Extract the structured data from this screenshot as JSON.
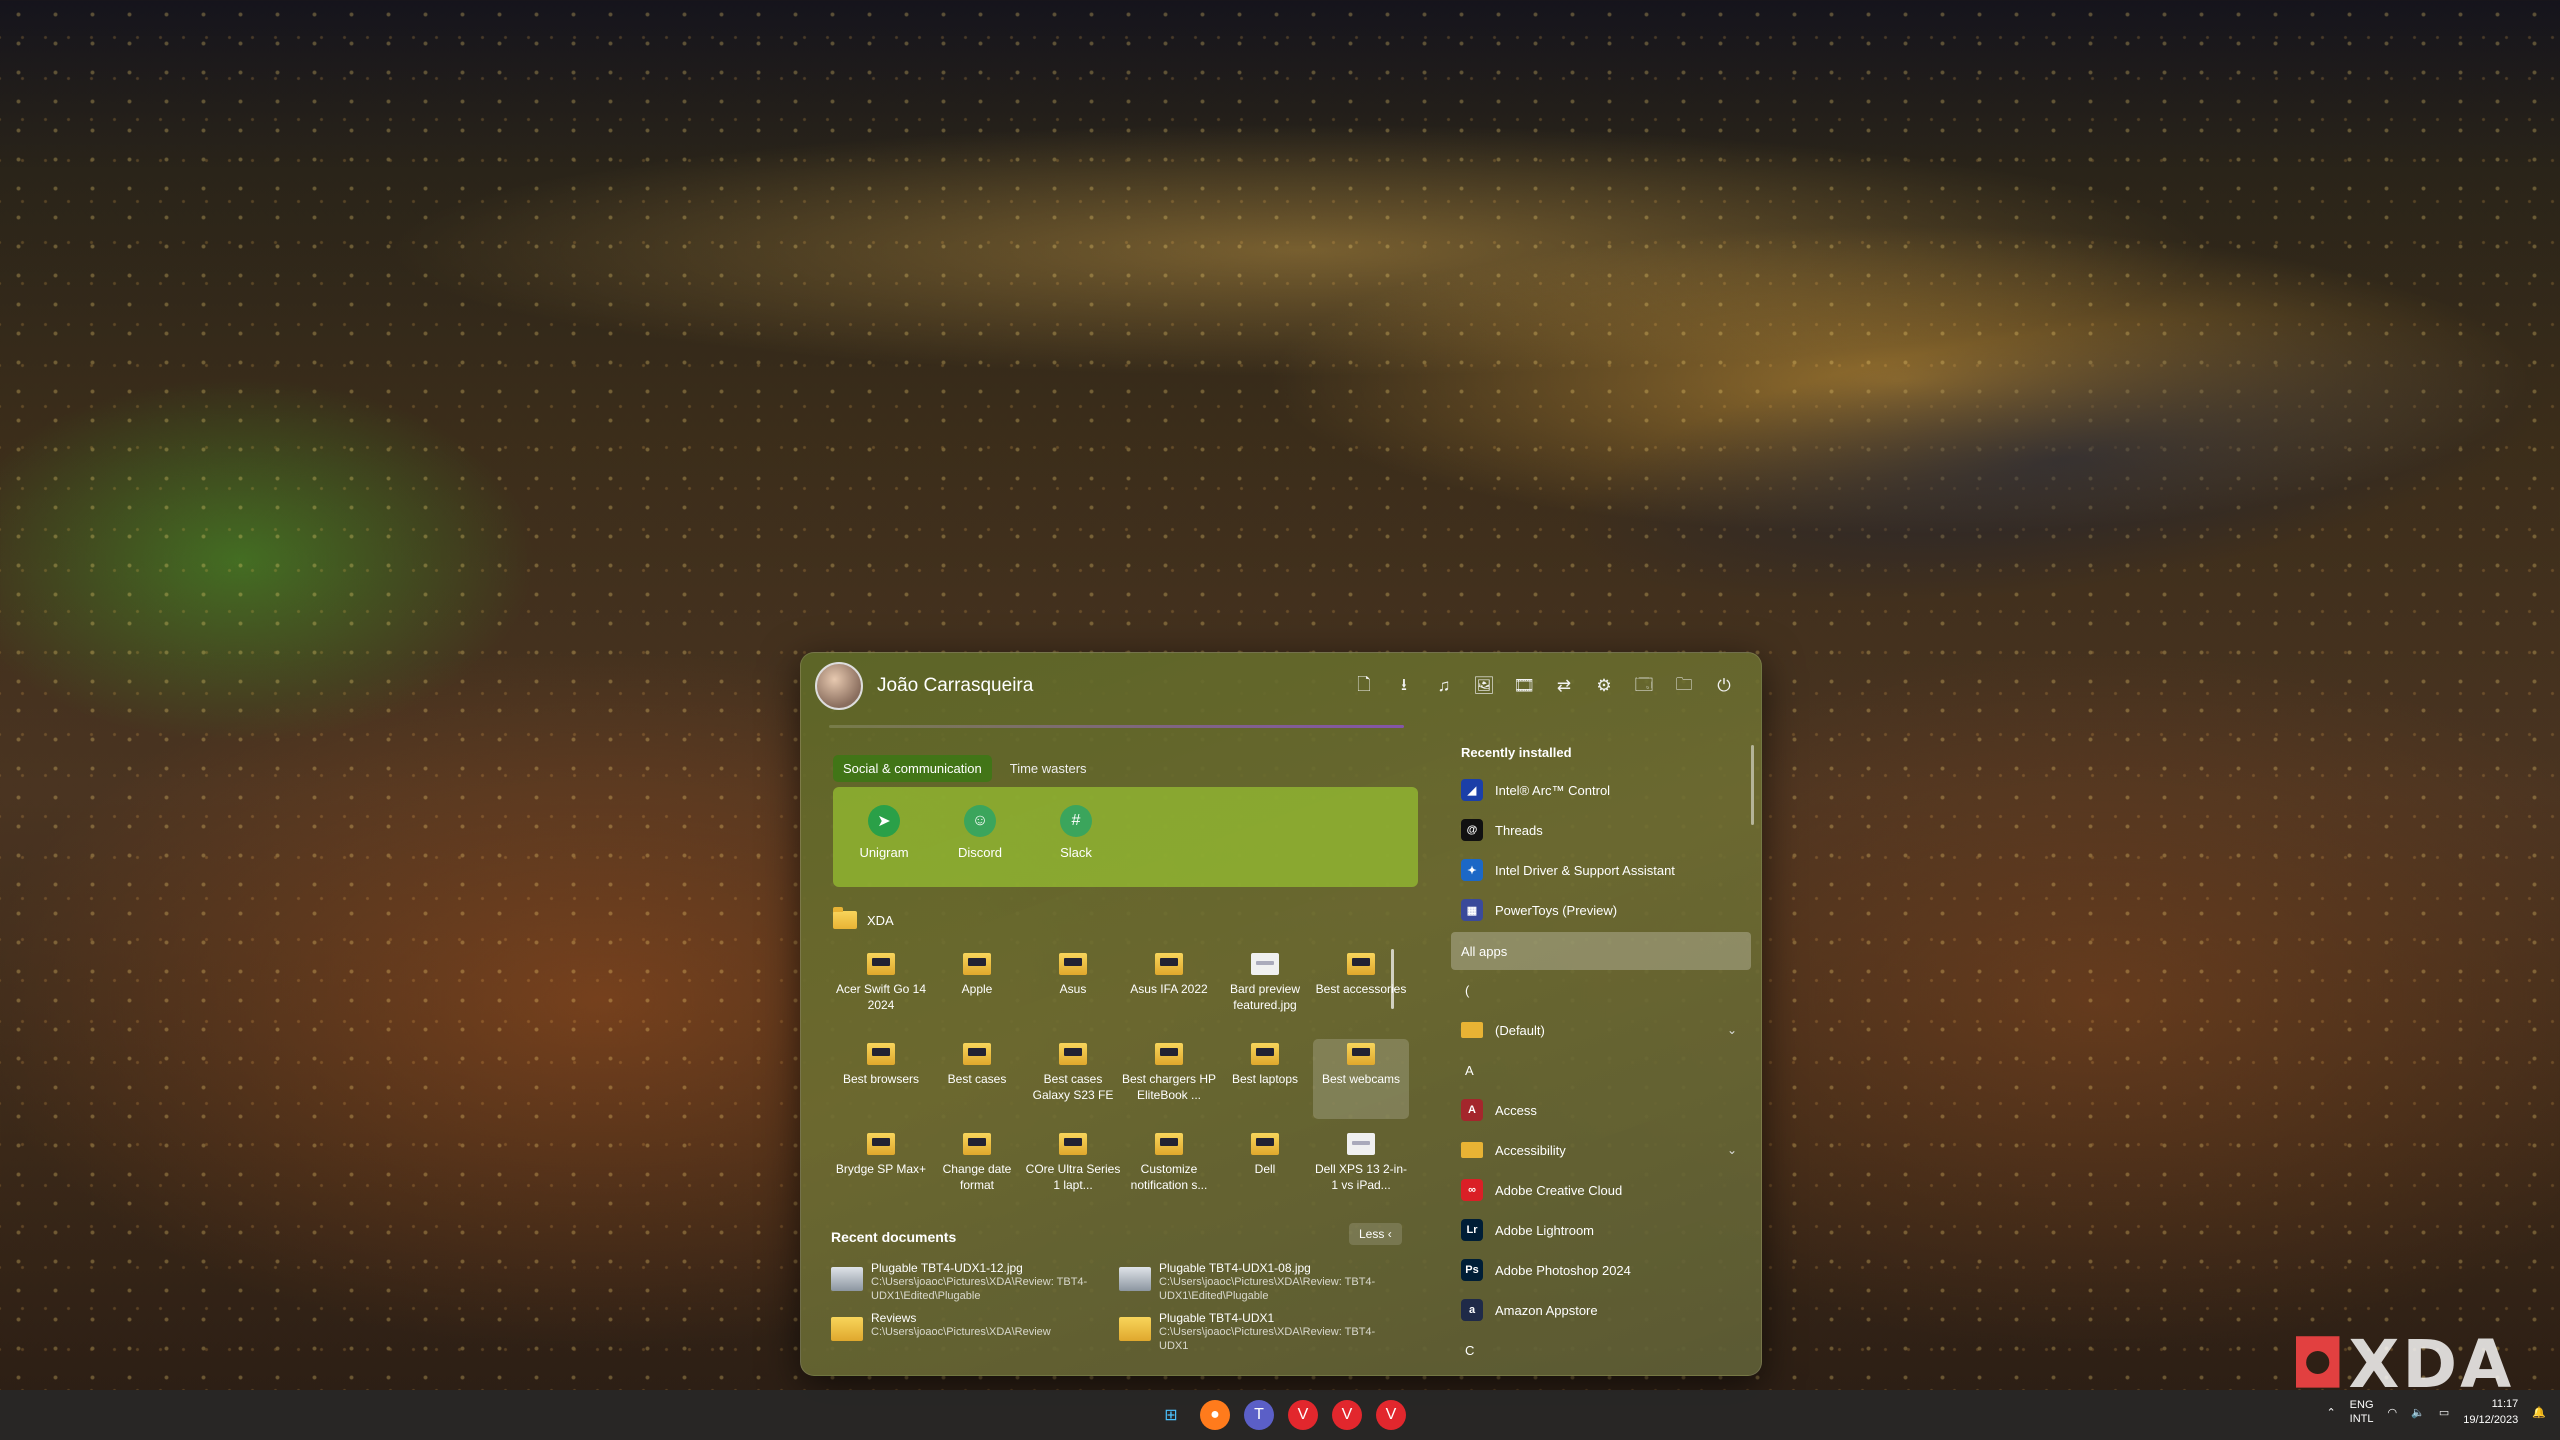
{
  "user": {
    "name": "João Carrasqueira"
  },
  "header_icons": [
    "document-icon",
    "download-icon",
    "music-icon",
    "image-icon",
    "video-icon",
    "network-icon",
    "settings-icon",
    "explorer-icon",
    "folder-icon",
    "power-icon"
  ],
  "tabs": [
    {
      "label": "Social & communication",
      "active": true
    },
    {
      "label": "Time wasters",
      "active": false
    }
  ],
  "group_apps": [
    {
      "label": "Unigram",
      "icon": "telegram-icon",
      "color": "#2aa048"
    },
    {
      "label": "Discord",
      "icon": "discord-icon",
      "color": "#3ba55c"
    },
    {
      "label": "Slack",
      "icon": "slack-icon",
      "color": "#3ba55c"
    }
  ],
  "folder": {
    "label": "XDA"
  },
  "folder_items": [
    {
      "label": "Acer Swift Go 14 2024",
      "type": "folder"
    },
    {
      "label": "Apple",
      "type": "folder"
    },
    {
      "label": "Asus",
      "type": "folder"
    },
    {
      "label": "Asus IFA 2022",
      "type": "folder"
    },
    {
      "label": "Bard preview featured.jpg",
      "type": "file"
    },
    {
      "label": "Best accessories",
      "type": "folder"
    },
    {
      "label": "Best browsers",
      "type": "folder"
    },
    {
      "label": "Best cases",
      "type": "folder"
    },
    {
      "label": "Best cases Galaxy S23 FE",
      "type": "folder"
    },
    {
      "label": "Best chargers HP EliteBook ...",
      "type": "folder"
    },
    {
      "label": "Best laptops",
      "type": "folder"
    },
    {
      "label": "Best webcams",
      "type": "folder",
      "selected": true
    },
    {
      "label": "Brydge SP Max+",
      "type": "folder"
    },
    {
      "label": "Change date format",
      "type": "folder"
    },
    {
      "label": "COre Ultra Series 1 lapt...",
      "type": "folder"
    },
    {
      "label": "Customize notification s...",
      "type": "folder"
    },
    {
      "label": "Dell",
      "type": "folder"
    },
    {
      "label": "Dell XPS 13 2-in-1 vs iPad...",
      "type": "file"
    }
  ],
  "recent": {
    "title": "Recent documents",
    "toggle": "Less",
    "items": [
      {
        "name": "Plugable TBT4-UDX1-12.jpg",
        "path": "C:\\Users\\joaoc\\Pictures\\XDA\\Review: TBT4-UDX1\\Edited\\Plugable",
        "type": "image"
      },
      {
        "name": "Plugable TBT4-UDX1-08.jpg",
        "path": "C:\\Users\\joaoc\\Pictures\\XDA\\Review: TBT4-UDX1\\Edited\\Plugable",
        "type": "image"
      },
      {
        "name": "Reviews",
        "path": "C:\\Users\\joaoc\\Pictures\\XDA\\Review",
        "type": "folder"
      },
      {
        "name": "Plugable TBT4-UDX1",
        "path": "C:\\Users\\joaoc\\Pictures\\XDA\\Review: TBT4-UDX1",
        "type": "folder"
      }
    ]
  },
  "right": {
    "recent_title": "Recently installed",
    "recent_items": [
      {
        "label": "Intel® Arc™ Control",
        "icon": "intel-arc-icon",
        "color": "#1b3fa8",
        "glyph": "◢"
      },
      {
        "label": "Threads",
        "icon": "threads-icon",
        "color": "#111111",
        "glyph": "@"
      },
      {
        "label": "Intel Driver & Support Assistant",
        "icon": "intel-dsa-icon",
        "color": "#1c68c6",
        "glyph": "✦"
      },
      {
        "label": "PowerToys (Preview)",
        "icon": "powertoys-icon",
        "color": "#3a4a9a",
        "glyph": "▦"
      }
    ],
    "all_apps": "All apps",
    "list": [
      {
        "kind": "letter",
        "label": "("
      },
      {
        "kind": "app",
        "label": "(Default)",
        "icon": "folder-icon",
        "color": "#e8b334",
        "glyph": "",
        "expand": true
      },
      {
        "kind": "letter",
        "label": "A"
      },
      {
        "kind": "app",
        "label": "Access",
        "icon": "access-icon",
        "color": "#a4262c",
        "glyph": "A"
      },
      {
        "kind": "app",
        "label": "Accessibility",
        "icon": "folder-icon",
        "color": "#e8b334",
        "glyph": "",
        "expand": true
      },
      {
        "kind": "app",
        "label": "Adobe Creative Cloud",
        "icon": "creative-cloud-icon",
        "color": "#da1f26",
        "glyph": "∞"
      },
      {
        "kind": "app",
        "label": "Adobe Lightroom",
        "icon": "lightroom-icon",
        "color": "#001e36",
        "glyph": "Lr"
      },
      {
        "kind": "app",
        "label": "Adobe Photoshop 2024",
        "icon": "photoshop-icon",
        "color": "#001e36",
        "glyph": "Ps"
      },
      {
        "kind": "app",
        "label": "Amazon Appstore",
        "icon": "amazon-appstore-icon",
        "color": "#1f2a48",
        "glyph": "a"
      },
      {
        "kind": "letter",
        "label": "C"
      }
    ]
  },
  "taskbar": {
    "apps": [
      "windows-icon",
      "firefox-icon",
      "teams-icon",
      "vivaldi-icon",
      "vivaldi-snapshot-icon",
      "vivaldi-icon"
    ],
    "lang_top": "ENG",
    "lang_bottom": "INTL",
    "time": "11:17",
    "date": "19/12/2023"
  },
  "watermark": "XDA"
}
